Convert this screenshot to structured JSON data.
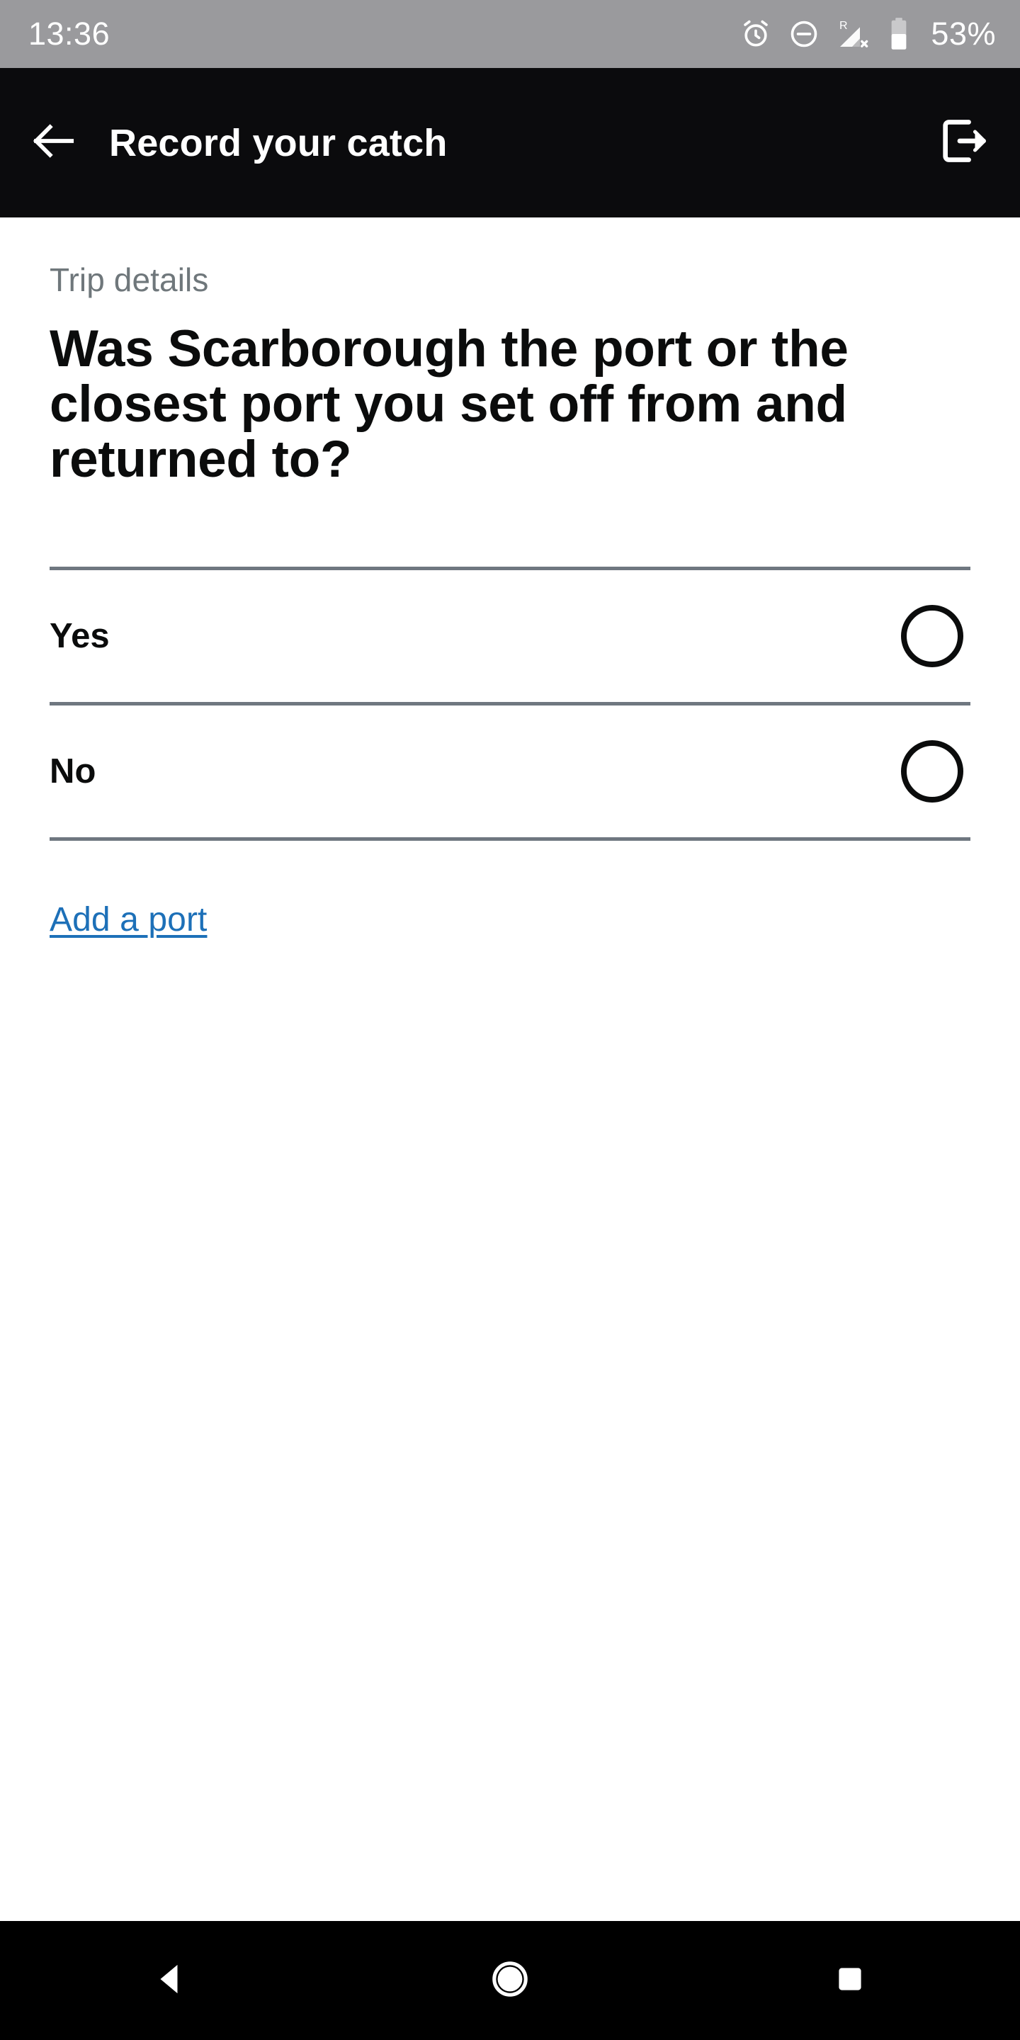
{
  "statusbar": {
    "time": "13:36",
    "battery_percent": "53%",
    "icons": [
      "alarm-icon",
      "do-not-disturb-icon",
      "signal-roaming-no-service-icon",
      "battery-icon"
    ],
    "roaming_label": "R",
    "background_color": "#9a9a9d",
    "text_color": "#ffffff"
  },
  "appbar": {
    "title": "Record your catch",
    "back_icon": "back-arrow-icon",
    "signout_icon": "sign-out-icon",
    "background_color": "#0b0b0d",
    "text_color": "#ffffff"
  },
  "main": {
    "caption": "Trip details",
    "question": "Was Scarborough the port or the closest port you set off from and returned to?",
    "options": [
      {
        "label": "Yes",
        "selected": false
      },
      {
        "label": "No",
        "selected": false
      }
    ],
    "add_link": "Add a port",
    "link_color": "#1d70b8",
    "divider_color": "#6f7780",
    "caption_color": "#6f777b",
    "heading_color": "#0b0c0c"
  },
  "navbar": {
    "back_label": "back-triangle-icon",
    "home_label": "home-circle-icon",
    "recents_label": "recents-square-icon",
    "background_color": "#000000"
  }
}
